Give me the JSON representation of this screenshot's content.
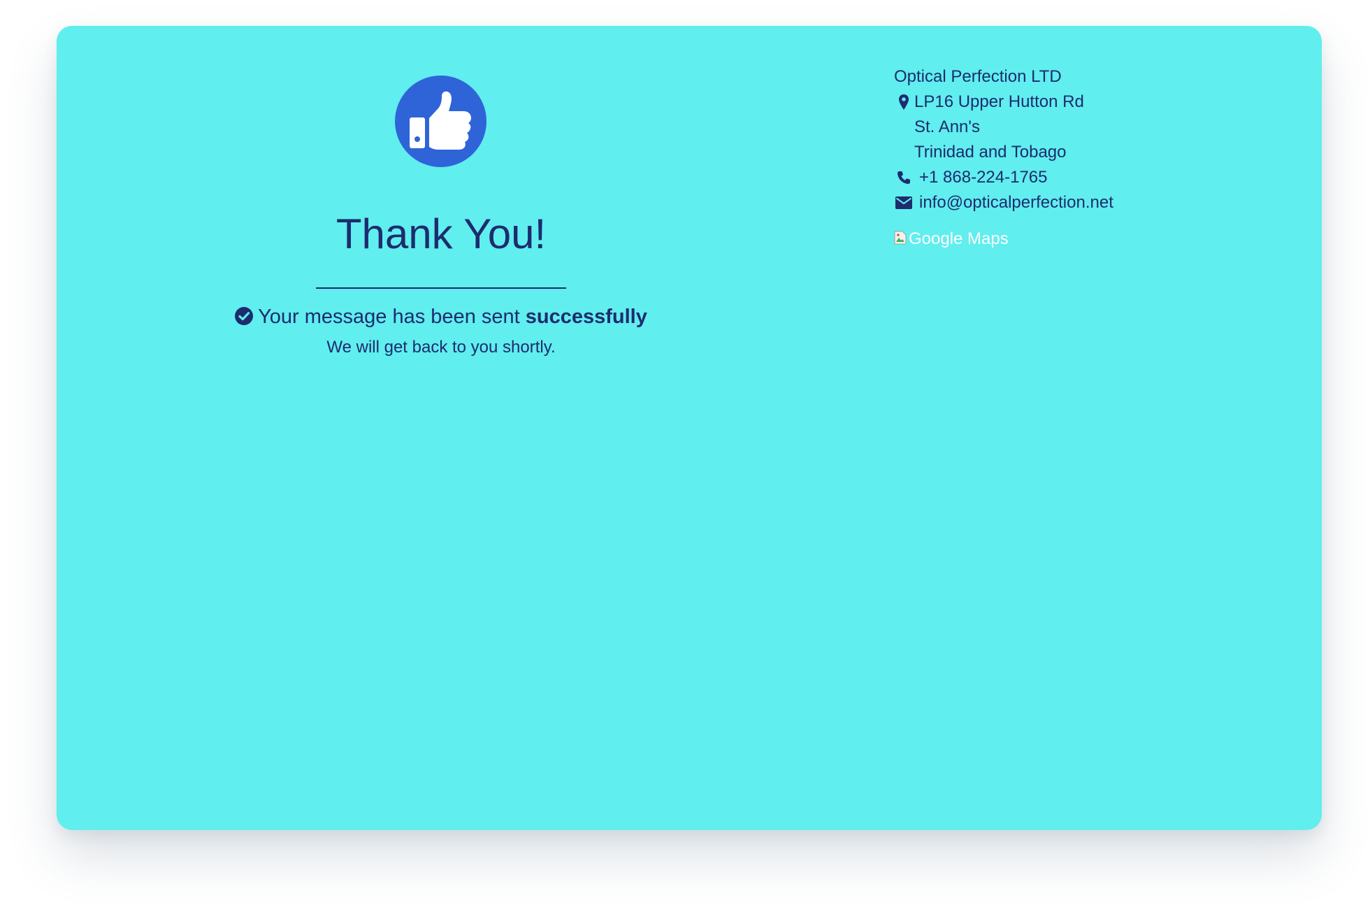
{
  "theme": {
    "card_background": "#60EEEE",
    "text_color": "#1D2C6E",
    "badge_color": "#2F64D8",
    "map_alt_color": "#FFFFFF"
  },
  "confirmation": {
    "badge_icon": "thumbs-up-icon",
    "heading": "Thank You!",
    "message_icon": "check-circle-icon",
    "message_prefix": "Your message has been sent",
    "message_emphasis": "successfully",
    "subtext": "We will get back to you shortly."
  },
  "contact": {
    "company": "Optical Perfection LTD",
    "address_icon": "map-marker-icon",
    "address_line1": "LP16 Upper Hutton Rd",
    "address_line2": "St. Ann's",
    "address_line3": "Trinidad and Tobago",
    "phone_icon": "phone-icon",
    "phone": "+1 868-224-1765",
    "email_icon": "envelope-icon",
    "email": "info@opticalperfection.net"
  },
  "map": {
    "icon": "broken-image-icon",
    "alt_text": "Google Maps"
  }
}
